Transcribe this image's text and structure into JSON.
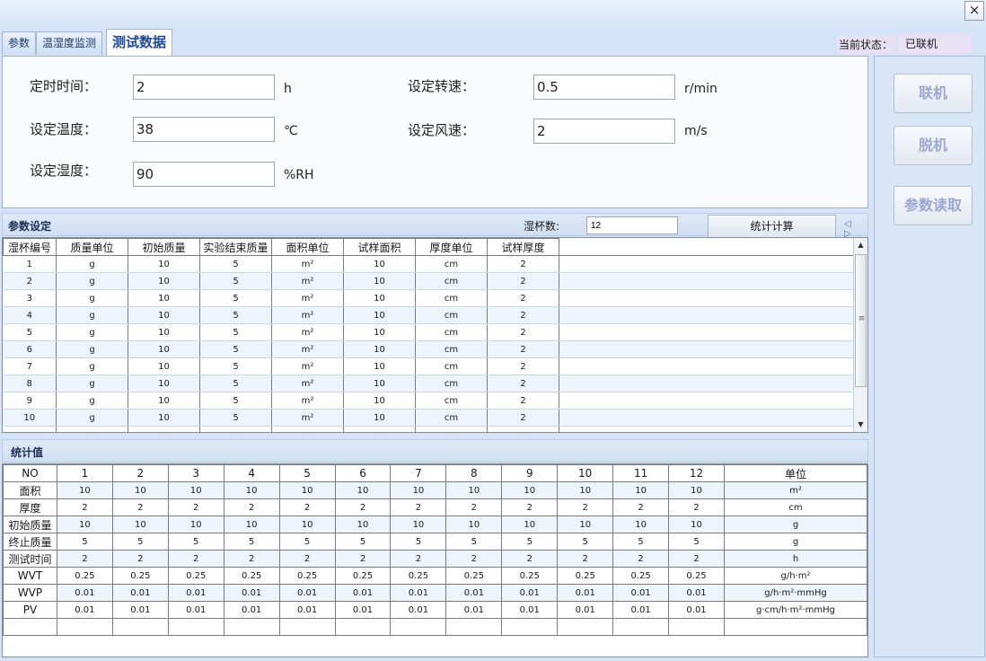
{
  "window": {
    "close_glyph": "×"
  },
  "tabs": [
    {
      "label": "参数"
    },
    {
      "label": "温湿度监测"
    },
    {
      "label": "测试数据"
    }
  ],
  "status": {
    "label": "当前状态：",
    "value": "已联机"
  },
  "settings": {
    "timer": {
      "label": "定时时间：",
      "value": "2",
      "unit": "h"
    },
    "temp": {
      "label": "设定温度：",
      "value": "38",
      "unit": "℃"
    },
    "humidity": {
      "label": "设定湿度：",
      "value": "90",
      "unit": "%RH"
    },
    "speed": {
      "label": "设定转速：",
      "value": "0.5",
      "unit": "r/min"
    },
    "wind": {
      "label": "设定风速：",
      "value": "2",
      "unit": "m/s"
    }
  },
  "side_buttons": {
    "connect": "联机",
    "disconnect": "脱机",
    "read_params": "参数读取"
  },
  "param_section": {
    "title": "参数设定",
    "cups_label": "湿杯数:",
    "cups_value": "12",
    "calc_button": "统计计算",
    "nav_arrows": "◁ ▷",
    "columns": [
      "湿杯编号",
      "质量单位",
      "初始质量",
      "实验结束质量",
      "面积单位",
      "试样面积",
      "厚度单位",
      "试样厚度"
    ],
    "rows": [
      [
        "1",
        "g",
        "10",
        "5",
        "m²",
        "10",
        "cm",
        "2"
      ],
      [
        "2",
        "g",
        "10",
        "5",
        "m²",
        "10",
        "cm",
        "2"
      ],
      [
        "3",
        "g",
        "10",
        "5",
        "m²",
        "10",
        "cm",
        "2"
      ],
      [
        "4",
        "g",
        "10",
        "5",
        "m²",
        "10",
        "cm",
        "2"
      ],
      [
        "5",
        "g",
        "10",
        "5",
        "m²",
        "10",
        "cm",
        "2"
      ],
      [
        "6",
        "g",
        "10",
        "5",
        "m²",
        "10",
        "cm",
        "2"
      ],
      [
        "7",
        "g",
        "10",
        "5",
        "m²",
        "10",
        "cm",
        "2"
      ],
      [
        "8",
        "g",
        "10",
        "5",
        "m²",
        "10",
        "cm",
        "2"
      ],
      [
        "9",
        "g",
        "10",
        "5",
        "m²",
        "10",
        "cm",
        "2"
      ],
      [
        "10",
        "g",
        "10",
        "5",
        "m²",
        "10",
        "cm",
        "2"
      ]
    ],
    "scroll_glyphs": {
      "up": "▲",
      "down": "▼",
      "grip": "≡"
    }
  },
  "stats_section": {
    "title": "统计值",
    "header": [
      "NO",
      "1",
      "2",
      "3",
      "4",
      "5",
      "6",
      "7",
      "8",
      "9",
      "10",
      "11",
      "12",
      "单位"
    ],
    "rows": [
      {
        "label": "面积",
        "values": [
          "10",
          "10",
          "10",
          "10",
          "10",
          "10",
          "10",
          "10",
          "10",
          "10",
          "10",
          "10"
        ],
        "unit": "m²"
      },
      {
        "label": "厚度",
        "values": [
          "2",
          "2",
          "2",
          "2",
          "2",
          "2",
          "2",
          "2",
          "2",
          "2",
          "2",
          "2"
        ],
        "unit": "cm"
      },
      {
        "label": "初始质量",
        "values": [
          "10",
          "10",
          "10",
          "10",
          "10",
          "10",
          "10",
          "10",
          "10",
          "10",
          "10",
          "10"
        ],
        "unit": "g"
      },
      {
        "label": "终止质量",
        "values": [
          "5",
          "5",
          "5",
          "5",
          "5",
          "5",
          "5",
          "5",
          "5",
          "5",
          "5",
          "5"
        ],
        "unit": "g"
      },
      {
        "label": "测试时间",
        "values": [
          "2",
          "2",
          "2",
          "2",
          "2",
          "2",
          "2",
          "2",
          "2",
          "2",
          "2",
          "2"
        ],
        "unit": "h"
      },
      {
        "label": "WVT",
        "values": [
          "0.25",
          "0.25",
          "0.25",
          "0.25",
          "0.25",
          "0.25",
          "0.25",
          "0.25",
          "0.25",
          "0.25",
          "0.25",
          "0.25"
        ],
        "unit": "g/h·m²"
      },
      {
        "label": "WVP",
        "values": [
          "0.01",
          "0.01",
          "0.01",
          "0.01",
          "0.01",
          "0.01",
          "0.01",
          "0.01",
          "0.01",
          "0.01",
          "0.01",
          "0.01"
        ],
        "unit": "g/h·m²·mmHg"
      },
      {
        "label": "PV",
        "values": [
          "0.01",
          "0.01",
          "0.01",
          "0.01",
          "0.01",
          "0.01",
          "0.01",
          "0.01",
          "0.01",
          "0.01",
          "0.01",
          "0.01"
        ],
        "unit": "g·cm/h·m²·mmHg"
      }
    ]
  }
}
